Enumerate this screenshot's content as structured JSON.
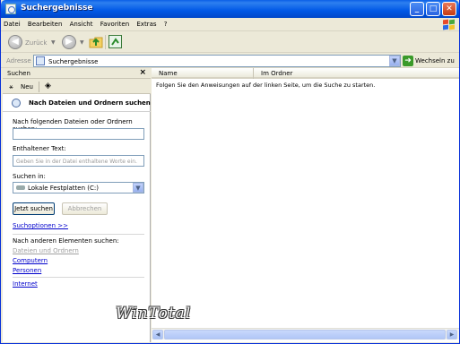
{
  "window": {
    "title": "Suchergebnisse"
  },
  "menu": [
    "Datei",
    "Bearbeiten",
    "Ansicht",
    "Favoriten",
    "Extras",
    "?"
  ],
  "toolbar": {
    "back_label": "Zurück"
  },
  "address": {
    "label": "Adresse",
    "value": "Suchergebnisse",
    "go_label": "Wechseln zu"
  },
  "search_panel": {
    "title": "Suchen",
    "close": "×",
    "new_label": "Neu",
    "heading": "Nach Dateien und Ordnern suchen",
    "files_label": "Nach folgenden Dateien oder Ordnern suchen:",
    "files_value": "",
    "content_label": "Enthaltener Text:",
    "content_placeholder": "Geben Sie in der Datei enthaltene Worte ein.",
    "lookin_label": "Suchen in:",
    "lookin_value": "Lokale Festplatten (C:)",
    "search_button": "Jetzt suchen",
    "cancel_button": "Abbrechen",
    "options_link": "Suchoptionen >>",
    "other_label": "Nach anderen Elementen suchen:",
    "links": [
      "Dateien und Ordnern",
      "Computern",
      "Personen"
    ],
    "internet_link": "Internet"
  },
  "results": {
    "columns": [
      "Name",
      "Im Ordner"
    ],
    "message": "Folgen Sie den Anweisungen auf der linken Seite, um die Suche zu starten."
  },
  "watermark": "WinTotal",
  "colors": {
    "titlebar": "#0058E6",
    "link": "#0000CC",
    "chrome": "#ECE9D8"
  }
}
